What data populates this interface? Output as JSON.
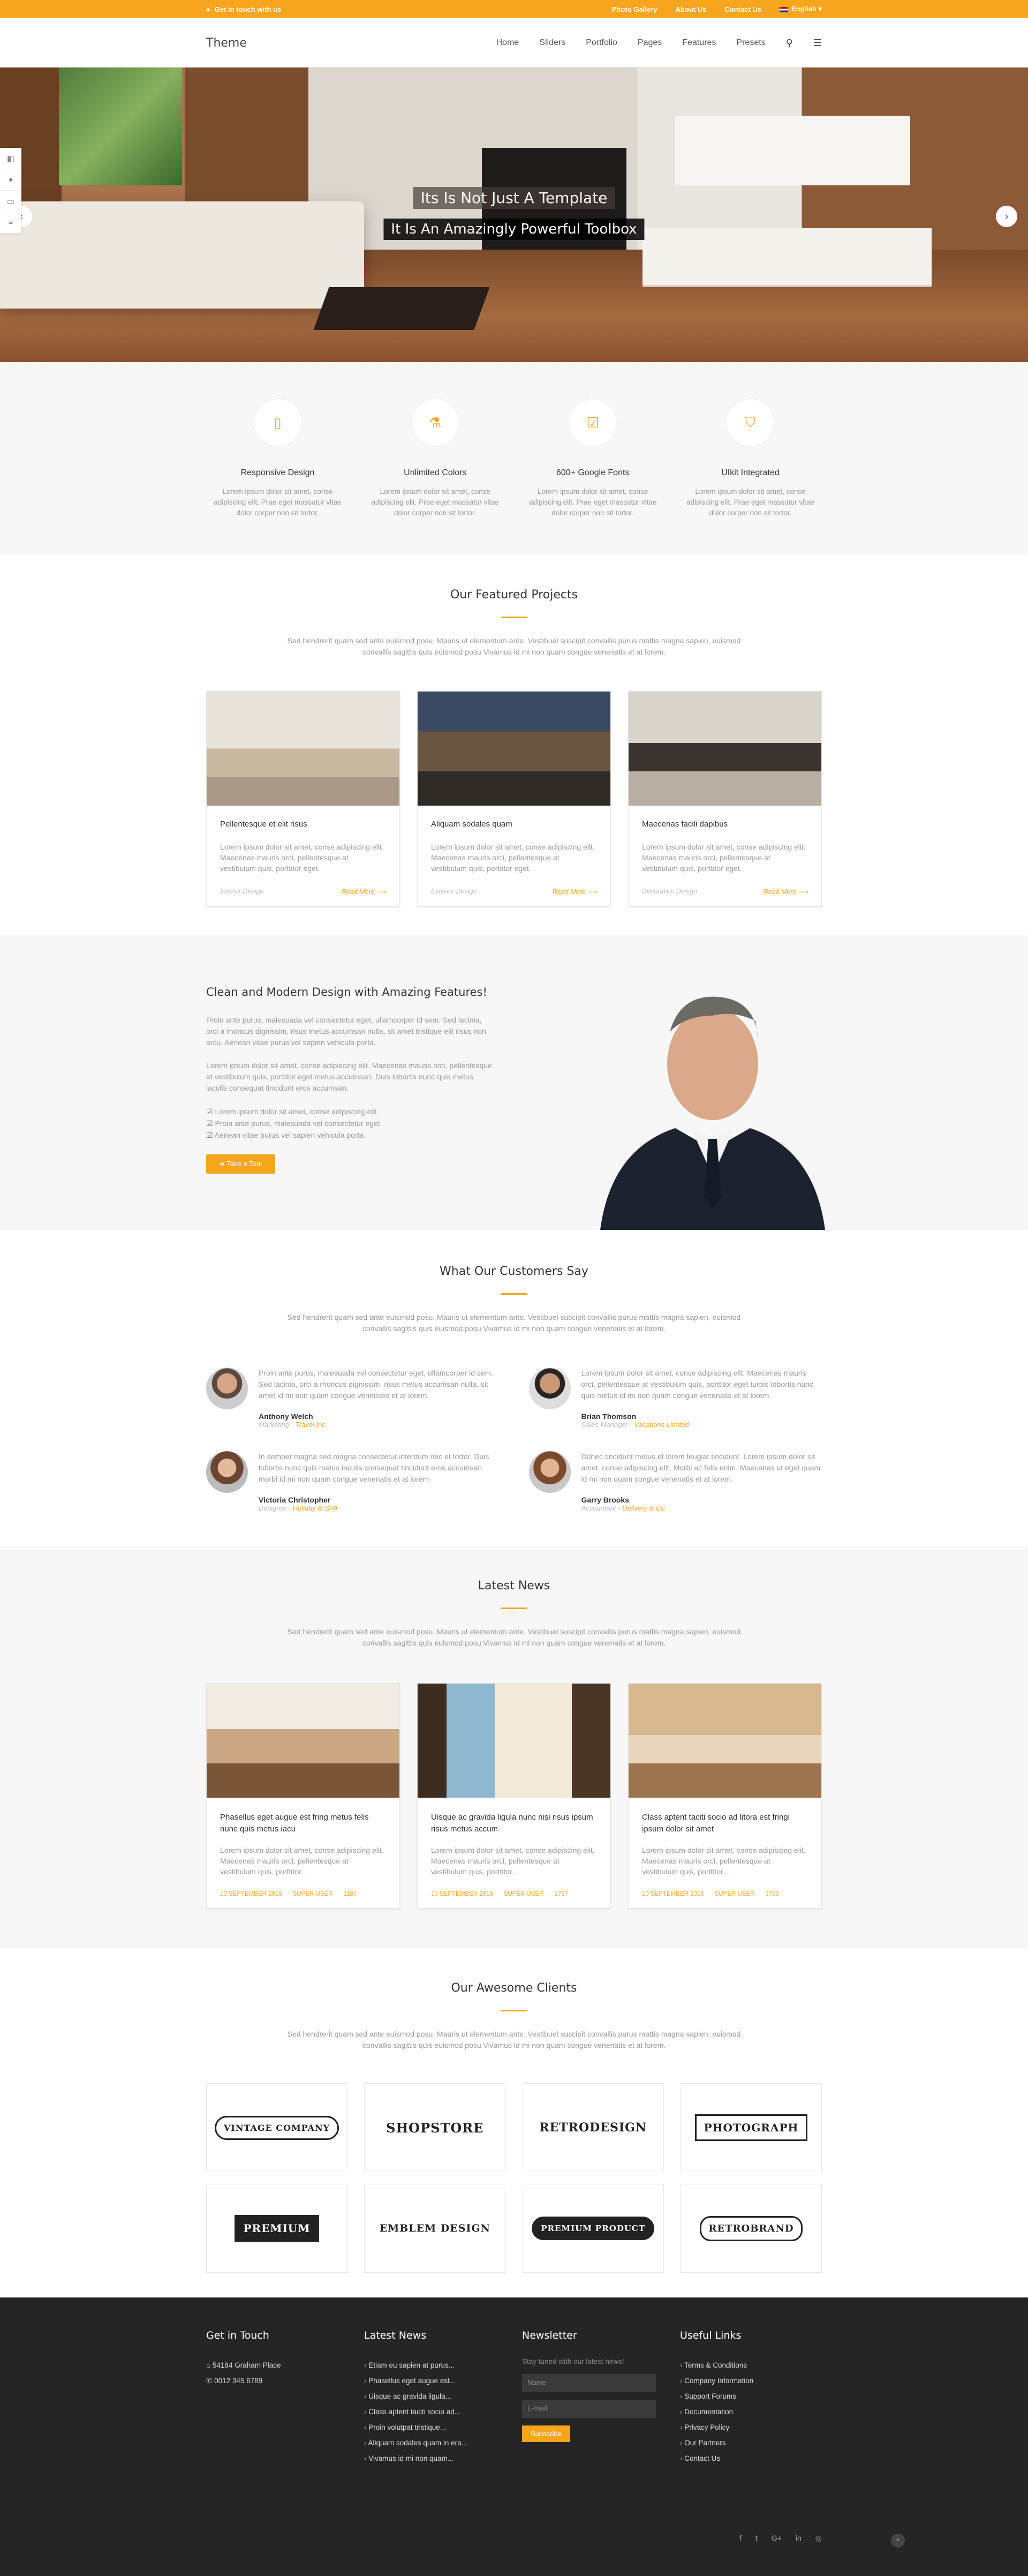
{
  "topbar": {
    "contact": "Get in touch with us",
    "links": [
      "Photo Gallery",
      "About Us",
      "Contact Us"
    ],
    "language": "English"
  },
  "header": {
    "logo": "Theme",
    "nav": [
      "Home",
      "Sliders",
      "Portfolio",
      "Pages",
      "Features",
      "Presets"
    ]
  },
  "hero": {
    "caption1": "Its Is Not Just A Template",
    "caption2": "It Is An Amazingly Powerful Toolbox"
  },
  "features": [
    {
      "title": "Responsive Design",
      "text": "Lorem ipsum dolor sit amet, conse adipiscing elit. Prae eget massatur vitae dolor corper non sit tortor.",
      "icon": "mobile-icon"
    },
    {
      "title": "Unlimited Colors",
      "text": "Lorem ipsum dolor sit amet, conse adipiscing elit. Prae eget massatur vitae dolor corper non sit tortor.",
      "icon": "flask-icon"
    },
    {
      "title": "600+ Google Fonts",
      "text": "Lorem ipsum dolor sit amet, conse adipiscing elit. Prae eget massatur vitae dolor corper non sit tortor.",
      "icon": "checkbox-icon"
    },
    {
      "title": "UIkit Integrated",
      "text": "Lorem ipsum dolor sit amet, conse adipiscing elit. Prae eget massatur vitae dolor corper non sit tortor.",
      "icon": "html5-icon"
    }
  ],
  "projects": {
    "title": "Our Featured Projects",
    "subtitle": "Sed hendrerit quam sed ante euismod posu. Mauris ut elementum ante. Vestibuel suscipit convallis purus mattis magna sapien, euismod convallis sagittis quis euismod posu Vivamus id mi non quam congue venenatis et at lorem.",
    "items": [
      {
        "title": "Pellentesque et elit risus",
        "text": "Lorem ipsum dolor sit amet, conse adipiscing elit. Maecenas mauris orci, pellentesque at vestibulum quis, porttitor eget.",
        "category": "Interior Design",
        "more": "Read More"
      },
      {
        "title": "Aliquam sodales quam",
        "text": "Lorem ipsum dolor sit amet, conse adipiscing elit. Maecenas mauris orci, pellentesque at vestibulum quis, porttitor eget.",
        "category": "Exterior Design",
        "more": "Read More"
      },
      {
        "title": "Maecenas facili dapibus",
        "text": "Lorem ipsum dolor sit amet, conse adipiscing elit. Maecenas mauris orci, pellentesque at vestibulum quis, porttitor eget.",
        "category": "Decoration Design",
        "more": "Read More"
      }
    ]
  },
  "about": {
    "title": "Clean and Modern Design with Amazing Features!",
    "p1": "Proin ante purus, malesuada vel consectetur eget, ullamcorper id sem. Sed lacinia, orci a rhoncus dignissim, risus metus accumsan nulla, sit amet tristique elit risus non arcu. Aenean vitae purus vel sapien vehicula porta.",
    "p2": "Lorem ipsum dolor sit amet, conse adipiscing elit. Maecenas mauris orci, pellentesque at vestibulum quis, porttitor eget metus accumsan. Duis lobortis nunc quis metus iaculis consequat tincidunt eros accumsan.",
    "list": [
      "Lorem ipsum dolor sit amet, conse adipiscing elit.",
      "Proin ante purus, malesuada vel consectetur eget.",
      "Aenean vitae purus vel sapien vehicula porta."
    ],
    "button": "Take a Tour"
  },
  "testimonials": {
    "title": "What Our Customers Say",
    "subtitle": "Sed hendrerit quam sed ante euismod posu. Mauris ut elementum ante. Vestibuel suscipit convallis purus mattis magna sapien, euismod convallis sagittis quis euismod posu Vivamus id mi non quam congue venenatis et at lorem.",
    "items": [
      {
        "text": "Proin ante purus, malesuada vel consectetur eget, ullamcorper id sem. Sed lacinia, orci a rhoncus dignissim, risus metus accumsan nulla, sit amet id mi non quam congue venenatis et at lorem.",
        "name": "Anthony Welch",
        "role": "Marketing",
        "company": "Travel Inc."
      },
      {
        "text": "Lorem ipsum dolor sit amet, conse adipiscing elit. Maecenas mauris orci, pellentesque at vestibulum quis, porttitor eget turpis lobortis nunc quis metus id mi non quam congue venenatis et at lorem.",
        "name": "Brian Thomson",
        "role": "Sales Manager",
        "company": "Vacations Limited"
      },
      {
        "text": "In semper magna sed magna consectetur interdum nec et tortor. Duis lobortis nunc quis metus iaculis consequat tincidunt eros accumsan morbi id mi non quam congue venenatis et at lorem.",
        "name": "Victoria Christopher",
        "role": "Designer",
        "company": "Holiday & SPA"
      },
      {
        "text": "Donec tincidunt metus et lorem feugiat tincidunt. Lorem ipsum dolor sit amet, conse adipiscing elit. Morbi ac felis enim. Maecenas ut eget quam id mi non quam congue venenatis et at lorem.",
        "name": "Garry Brooks",
        "role": "Accountant",
        "company": "Delivery & Co."
      }
    ]
  },
  "news": {
    "title": "Latest News",
    "subtitle": "Sed hendrerit quam sed ante euismod posu. Mauris ut elementum ante. Vestibuel suscipit convallis purus mattis magna sapien, euismod convallis sagittis quis euismod posu Vivamus id mi non quam congue venenatis et at lorem.",
    "items": [
      {
        "title": "Phasellus eget augue est fring metus felis nunc quis metus iacu",
        "text": "Lorem ipsum dolor sit amet, conse adipiscing elit. Maecenas mauris orci, pellentesque at vestibulum quis, porttitor...",
        "date": "10 SEPTEMBER 2016",
        "author": "SUPER USER",
        "views": "1187"
      },
      {
        "title": "Uisque ac gravida ligula nunc nisi risus ipsum risus metus accum",
        "text": "Lorem ipsum dolor sit amet, conse adipiscing elit. Maecenas mauris orci, pellentesque at vestibulum quis, porttitor...",
        "date": "10 SEPTEMBER 2016",
        "author": "SUPER USER",
        "views": "1737"
      },
      {
        "title": "Class aptent taciti socio ad litora est fringi ipsum dolor sit amet",
        "text": "Lorem ipsum dolor sit amet, conse adipiscing elit. Maecenas mauris orci, pellentesque at vestibulum quis, porttitor...",
        "date": "10 SEPTEMBER 2016",
        "author": "SUPER USER",
        "views": "1753"
      }
    ]
  },
  "clients": {
    "title": "Our Awesome Clients",
    "subtitle": "Sed hendrerit quam sed ante euismod posu. Mauris ut elementum ante. Vestibuel suscipit convallis purus mattis magna sapien, euismod convallis sagittis quis euismod posu Vivamus id mi non quam congue venenatis et at lorem.",
    "logos": [
      "VINTAGE COMPANY",
      "SHOPSTORE",
      "RETRODESIGN",
      "PHOTOGRAPH",
      "PREMIUM",
      "EMBLEM DESIGN",
      "PREMIUM PRODUCT",
      "RETROBRAND"
    ]
  },
  "footer": {
    "col1": {
      "title": "Get in Touch",
      "address": "54184 Graham Place",
      "phone": "0012 345 6789"
    },
    "col2": {
      "title": "Latest News",
      "items": [
        "Etiam eu sapien at purus...",
        "Phasellus eget augue est...",
        "Uisque ac gravida ligula...",
        "Class aptent taciti socio ad...",
        "Proin volutpat tristique...",
        "Aliquam sodales quam in era...",
        "Vivamus id mi non quam..."
      ]
    },
    "col3": {
      "title": "Newsletter",
      "text": "Stay tuned with our latest news!",
      "name_placeholder": "Name",
      "email_placeholder": "E-mail",
      "button": "Subscribe"
    },
    "col4": {
      "title": "Useful Links",
      "items": [
        "Terms & Conditions",
        "Company Information",
        "Support Forums",
        "Documentation",
        "Privacy Policy",
        "Our Partners",
        "Contact Us"
      ]
    }
  },
  "colors": {
    "accent": "#f7a51d",
    "footer": "#252525"
  }
}
